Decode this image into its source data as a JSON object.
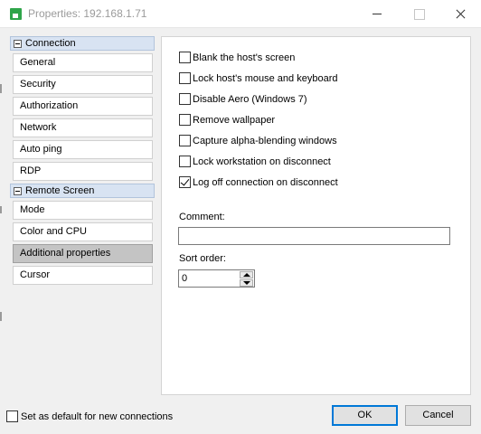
{
  "window": {
    "title": "Properties: 192.168.1.71"
  },
  "nav": {
    "groups": [
      {
        "label": "Connection",
        "items": [
          "General",
          "Security",
          "Authorization",
          "Network",
          "Auto ping",
          "RDP"
        ]
      },
      {
        "label": "Remote Screen",
        "items": [
          "Mode",
          "Color and CPU",
          "Additional properties",
          "Cursor"
        ]
      }
    ],
    "selected": "Additional properties"
  },
  "options": [
    {
      "label": "Blank the host's screen",
      "checked": false
    },
    {
      "label": "Lock host's mouse and keyboard",
      "checked": false
    },
    {
      "label": "Disable Aero (Windows 7)",
      "checked": false
    },
    {
      "label": "Remove wallpaper",
      "checked": false
    },
    {
      "label": "Capture alpha-blending windows",
      "checked": false
    },
    {
      "label": "Lock workstation on disconnect",
      "checked": false
    },
    {
      "label": "Log off connection on disconnect",
      "checked": true
    }
  ],
  "comment": {
    "label": "Comment:",
    "value": ""
  },
  "sort_order": {
    "label": "Sort order:",
    "value": "0"
  },
  "footer": {
    "default_label": "Set as default for new connections",
    "default_checked": false,
    "ok_label": "OK",
    "cancel_label": "Cancel"
  },
  "colors": {
    "selected_item_bg": "#c4c4c4",
    "group_header_bg": "#d8e3f2",
    "ok_border": "#0078d7",
    "app_icon": "#2fa54a"
  }
}
